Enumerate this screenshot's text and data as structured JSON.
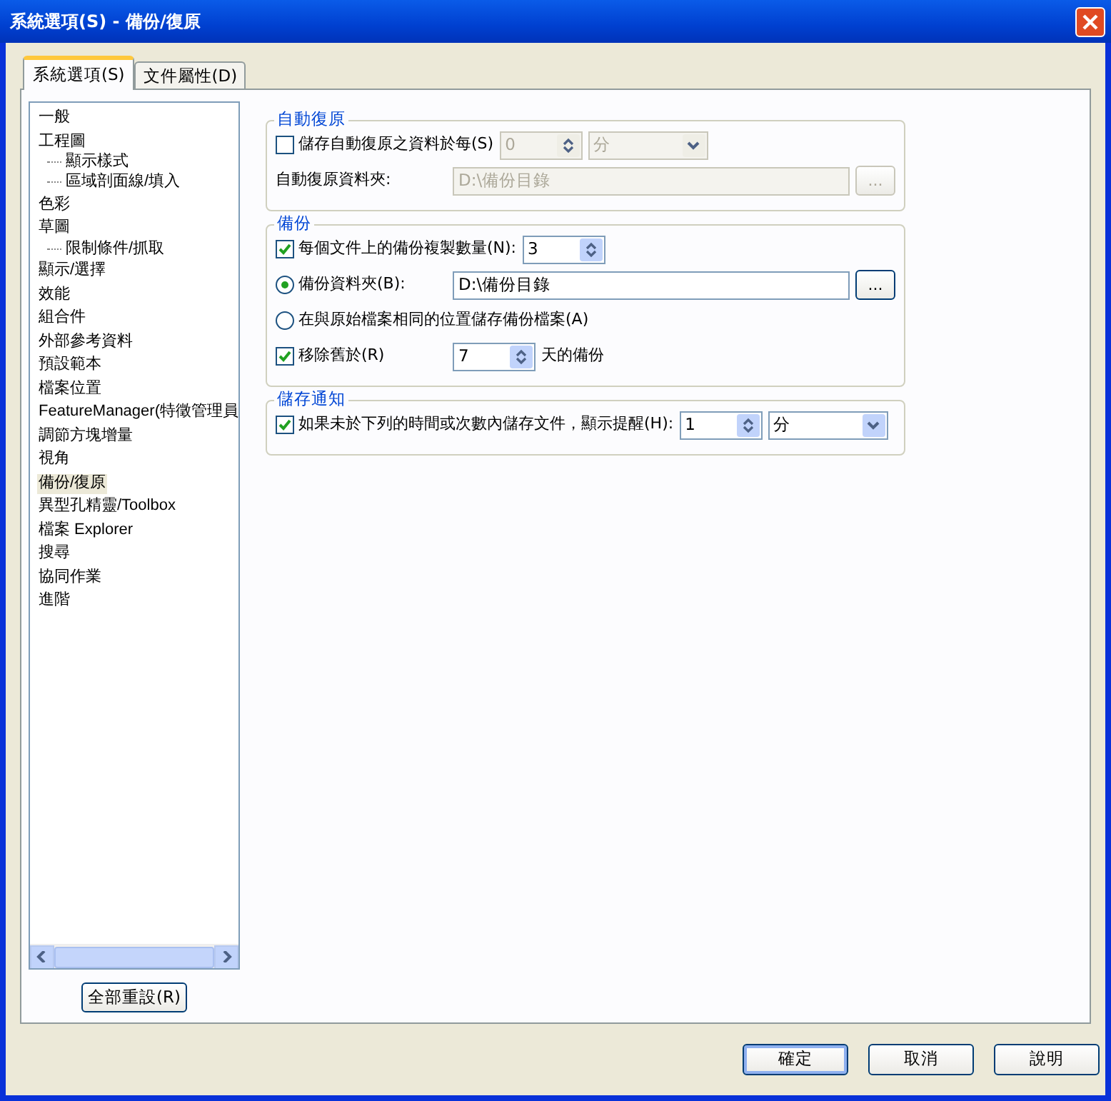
{
  "window": {
    "title": "系統選項(S) - 備份/復原"
  },
  "tabs": [
    {
      "label": "系統選項(S)",
      "selected": true
    },
    {
      "label": "文件屬性(D)",
      "selected": false
    }
  ],
  "tree": {
    "items": [
      {
        "label": "一般",
        "selected": false
      },
      {
        "label": "工程圖",
        "selected": false,
        "children": [
          {
            "label": "顯示樣式",
            "selected": false
          },
          {
            "label": "區域剖面線/填入",
            "selected": false
          }
        ]
      },
      {
        "label": "色彩",
        "selected": false
      },
      {
        "label": "草圖",
        "selected": false,
        "children": [
          {
            "label": "限制條件/抓取",
            "selected": false
          }
        ]
      },
      {
        "label": "顯示/選擇",
        "selected": false
      },
      {
        "label": "效能",
        "selected": false
      },
      {
        "label": "組合件",
        "selected": false
      },
      {
        "label": "外部參考資料",
        "selected": false
      },
      {
        "label": "預設範本",
        "selected": false
      },
      {
        "label": "檔案位置",
        "selected": false
      },
      {
        "label": "FeatureManager(特徵管理員",
        "selected": false
      },
      {
        "label": "調節方塊增量",
        "selected": false
      },
      {
        "label": "視角",
        "selected": false
      },
      {
        "label": "備份/復原",
        "selected": true
      },
      {
        "label": "異型孔精靈/Toolbox",
        "selected": false
      },
      {
        "label": "檔案 Explorer",
        "selected": false
      },
      {
        "label": "搜尋",
        "selected": false
      },
      {
        "label": "協同作業",
        "selected": false
      },
      {
        "label": "進階",
        "selected": false
      }
    ]
  },
  "reset_button": "全部重設(R)",
  "groups": [
    {
      "title": "自動復原",
      "rows": [
        {
          "controls": [
            {
              "kind": "checkbox",
              "label": "儲存自動復原之資料於每(S)",
              "checked": false,
              "disabled": false
            },
            {
              "kind": "spin",
              "value": "0",
              "disabled": true
            },
            {
              "kind": "select",
              "value": "分",
              "disabled": true
            }
          ]
        },
        {
          "controls": [
            {
              "kind": "text",
              "label": "自動復原資料夾:"
            },
            {
              "kind": "path",
              "value": "D:\\備份目錄",
              "disabled": true
            },
            {
              "kind": "browse",
              "label": "...",
              "disabled": true
            }
          ]
        }
      ]
    },
    {
      "title": "備份",
      "rows": [
        {
          "controls": [
            {
              "kind": "checkbox",
              "label": "每個文件上的備份複製數量(N):",
              "checked": true,
              "disabled": false
            },
            {
              "kind": "spin",
              "value": "3",
              "disabled": false
            }
          ]
        },
        {
          "controls": [
            {
              "kind": "radio",
              "label": "備份資料夾(B):",
              "selected": true
            },
            {
              "kind": "path",
              "value": "D:\\備份目錄",
              "disabled": false
            },
            {
              "kind": "browse",
              "label": "...",
              "disabled": false
            }
          ]
        },
        {
          "controls": [
            {
              "kind": "radio",
              "label": "在與原始檔案相同的位置儲存備份檔案(A)",
              "selected": false
            }
          ]
        },
        {
          "controls": [
            {
              "kind": "checkbox",
              "label": "移除舊於(R)",
              "checked": true,
              "disabled": false
            },
            {
              "kind": "spin",
              "value": "7",
              "disabled": false
            },
            {
              "kind": "text",
              "label": "天的備份"
            }
          ]
        }
      ]
    },
    {
      "title": "儲存通知",
      "rows": [
        {
          "controls": [
            {
              "kind": "checkbox",
              "label": "如果未於下列的時間或次數內儲存文件，顯示提醒(H):",
              "checked": true,
              "disabled": false
            },
            {
              "kind": "spin",
              "value": "1",
              "disabled": false
            },
            {
              "kind": "select",
              "value": "分",
              "disabled": false
            }
          ]
        }
      ]
    }
  ],
  "buttons": [
    "確定",
    "取消",
    "說明"
  ]
}
